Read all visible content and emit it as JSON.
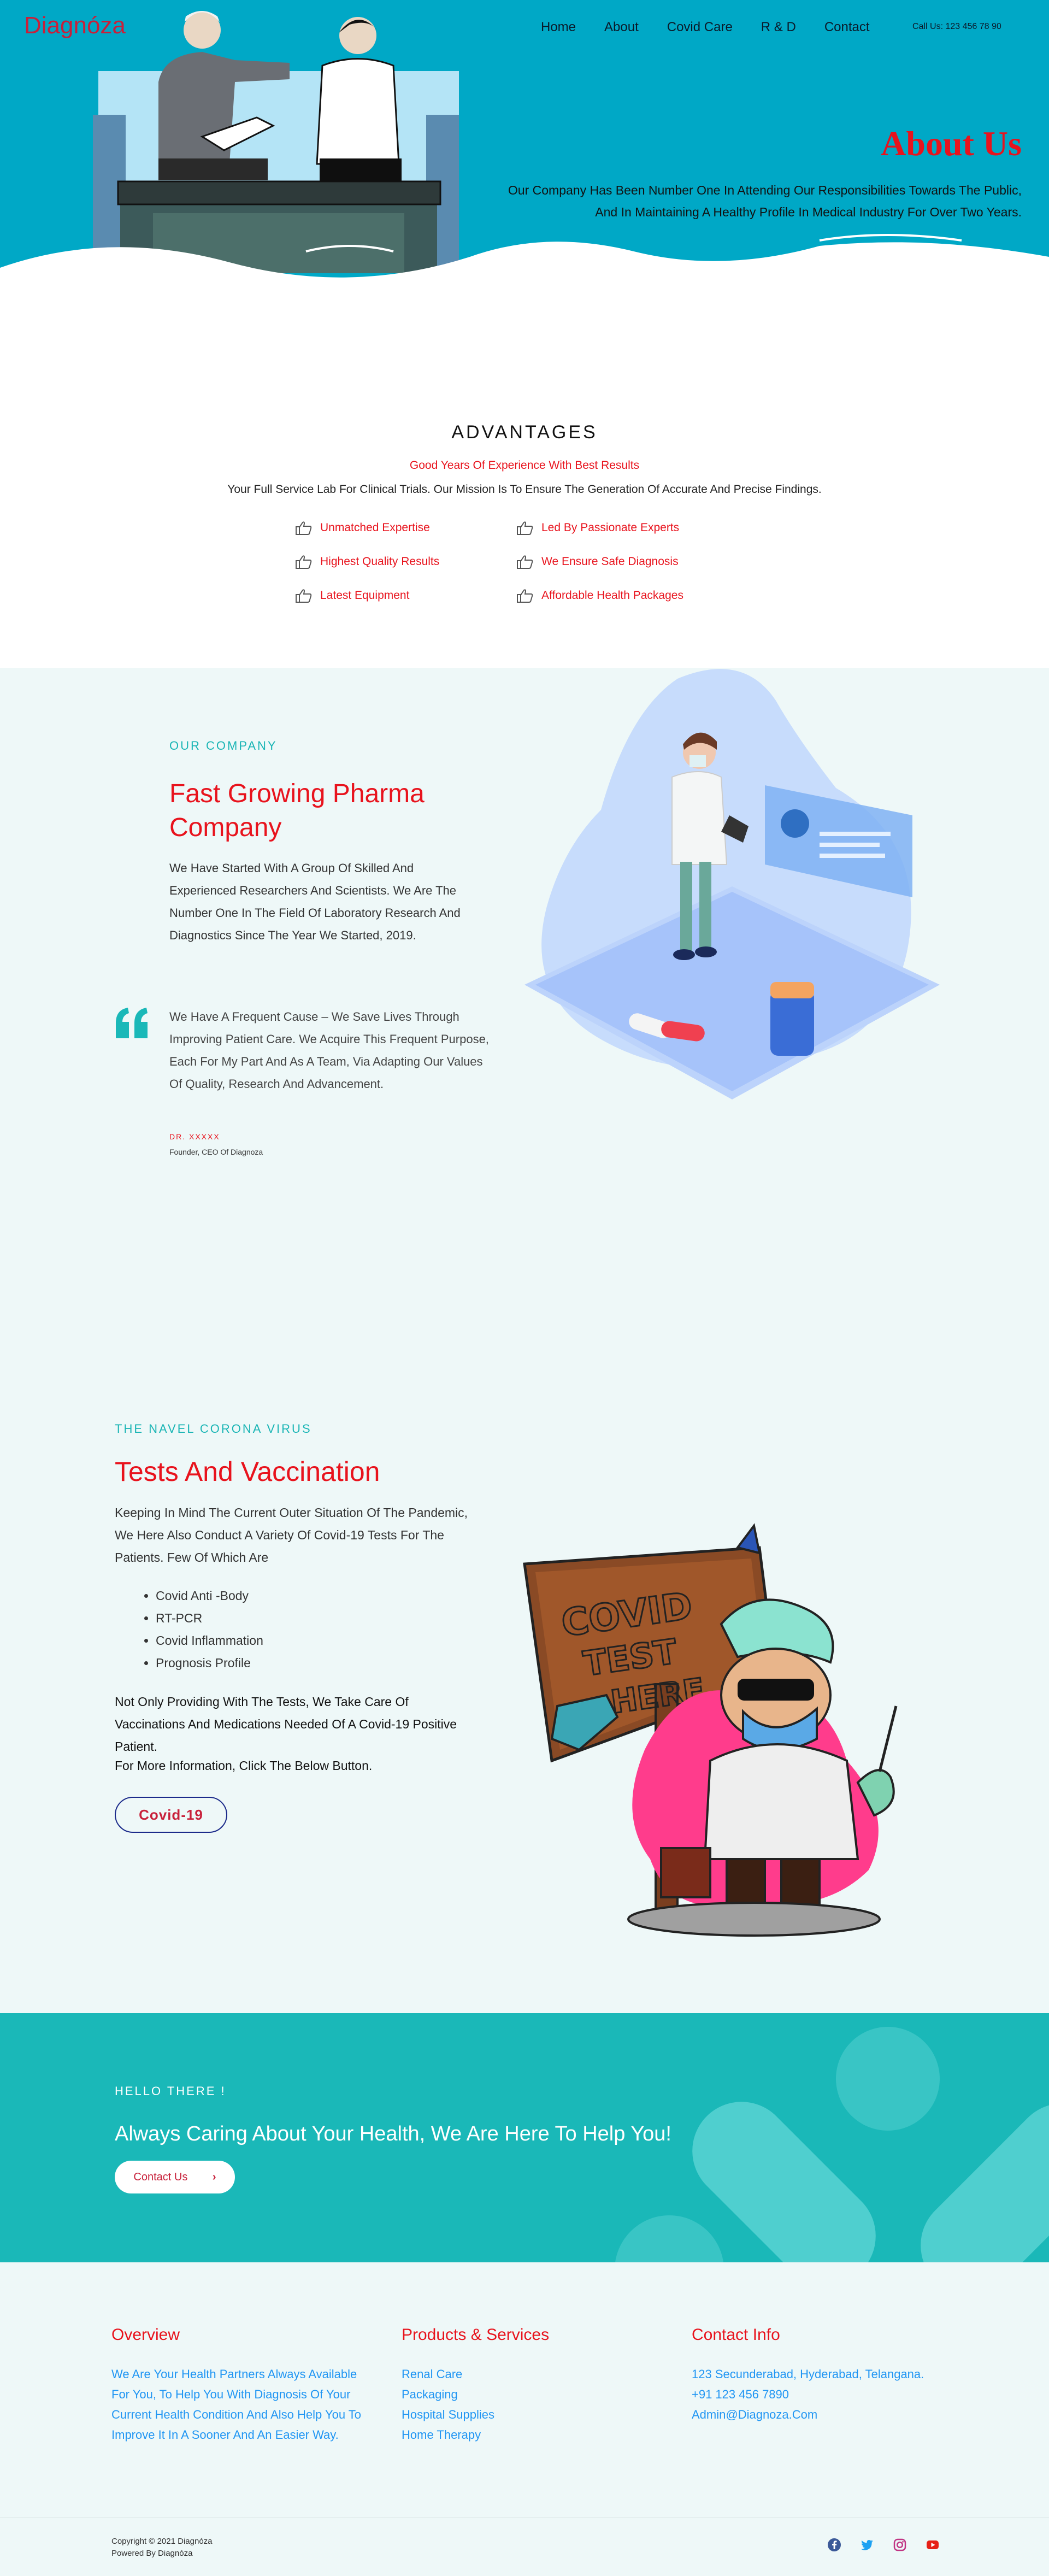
{
  "header": {
    "brand": "Diagnóza",
    "nav": [
      "Home",
      "About",
      "Covid Care",
      "R & D",
      "Contact"
    ],
    "call": "Call Us: 123 456 78 90"
  },
  "hero": {
    "title": "About Us",
    "text": "Our  Company Has Been Number One In Attending Our Responsibilities Towards The Public, And In Maintaining A Healthy Profile In Medical Industry For Over Two Years."
  },
  "advantages": {
    "title": "ADVANTAGES",
    "subtitle": "Good Years Of Experience With Best Results",
    "mission": "Your Full Service Lab For Clinical Trials. Our Mission Is To Ensure The Generation Of Accurate And Precise Findings.",
    "items": [
      "Unmatched Expertise",
      "Led By Passionate Experts",
      "Highest Quality Results",
      "We Ensure Safe Diagnosis",
      "Latest Equipment",
      "Affordable Health Packages"
    ]
  },
  "company": {
    "eyebrow": "OUR COMPANY",
    "title": "Fast Growing Pharma Company",
    "description": "We Have Started With A Group Of Skilled And Experienced Researchers And Scientists. We Are The Number One In The Field Of Laboratory Research And Diagnostics Since The Year We Started, 2019.",
    "quote": "We Have A Frequent Cause – We Save Lives Through Improving Patient Care. We Acquire This Frequent Purpose, Each For My Part And As A Team, Via Adapting Our Values Of Quality, Research And Advancement.",
    "author": "DR. XXXXX",
    "role": "Founder, CEO Of Diagnoza"
  },
  "covid": {
    "eyebrow": "THE NAVEL CORONA VIRUS",
    "title": "Tests And Vaccination",
    "description": "Keeping In Mind The Current Outer Situation Of The Pandemic, We Here Also Conduct A Variety Of Covid-19 Tests For The Patients. Few Of Which Are",
    "tests": [
      "Covid Anti -Body",
      "RT-PCR",
      "Covid Inflammation",
      "Prognosis Profile"
    ],
    "description2": "Not Only Providing With The Tests, We Take Care Of Vaccinations And Medications Needed Of A Covid-19 Positive Patient.",
    "description3": "For More Information, Click The Below Button.",
    "button": "Covid-19",
    "sign": [
      "COVID",
      "TEST",
      "HERE"
    ]
  },
  "hello": {
    "eyebrow": "HELLO THERE !",
    "title": "Always Caring About Your Health, We Are Here To Help You!",
    "button": "Contact Us",
    "button_arrow": "›"
  },
  "footer": {
    "overview_title": "Overview",
    "overview_text": "We  Are Your Health Partners Always Available For You, To Help You With Diagnosis Of Your Current Health Condition And Also Help You To Improve It In A Sooner And An Easier Way.",
    "products_title": "Products & Services",
    "products": [
      "Renal Care",
      "Packaging",
      "Hospital Supplies",
      "Home Therapy"
    ],
    "contact_title": "Contact Info",
    "contact": [
      "123 Secunderabad, Hyderabad, Telangana.",
      "+91 123 456 7890",
      "Admin@Diagnoza.Com"
    ],
    "copyright": "Copyright © 2021 Diagnóza",
    "powered": "Powered By Diagnóza",
    "socials": [
      "facebook-icon",
      "twitter-icon",
      "instagram-icon",
      "youtube-icon"
    ]
  },
  "colors": {
    "hero_bg": "#00a8c6",
    "accent_red": "#e8131d",
    "teal": "#1ab8b8",
    "light_bg": "#eef8f8",
    "link_blue": "#2196f3"
  }
}
